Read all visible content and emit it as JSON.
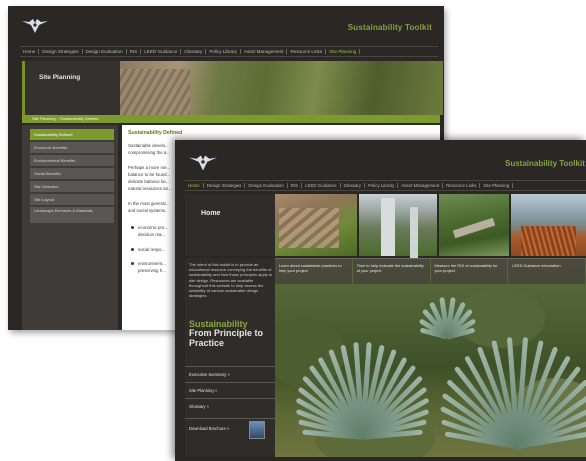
{
  "back": {
    "brand": "Sustainability Toolkit",
    "nav": [
      "Home",
      "Design Strategies",
      "Design Evaluation",
      "RIS",
      "LEED Guidance",
      "Glossary",
      "Policy Library",
      "Asset Management",
      "Resource Links",
      "Site Planning"
    ],
    "nav_active": 9,
    "hero_title": "Site Planning",
    "breadcrumb": "Site Planning :: Sustainability Defined",
    "sidebar": [
      "Sustainability Defined",
      "Economic Benefits",
      "Environmental Benefits",
      "Social Benefits",
      "Site Selection",
      "Site Layout",
      "Landscape Elements & Materials"
    ],
    "sidebar_active": 0,
    "content_heading": "Sustainability Defined",
    "content_text": [
      "Sustainable develo...",
      "compromising the a...",
      "Perhaps a more me...",
      "balance to be found...",
      "delicate balance be...",
      "natural resources an...",
      "In the most general...",
      "and social systems...",
      "economic pro...",
      "decision ma...",
      "social respo...",
      "environment...",
      "preserving h..."
    ]
  },
  "front": {
    "brand": "Sustainability Toolkit",
    "nav": [
      "Home",
      "Design Strategies",
      "Design Evaluation",
      "RIS",
      "LEED Guidance",
      "Glossary",
      "Policy Library",
      "Asset Management",
      "Resource Links",
      "Site Planning"
    ],
    "nav_active": 0,
    "home_title": "Home",
    "intro": "The intent of this toolkit is to provide an educational resource conveying the benefits of sustainability and how those principles apply to site design. Resources are available throughout this website to help assess the suitability of various sustainable design strategies.",
    "tagline_1": "Sustainability",
    "tagline_2": "From Principle to Practice",
    "links": [
      "Executive Summary »",
      "Site Planning »",
      "Glossary »"
    ],
    "download": "Download Brochure »",
    "features": [
      "Learn about sustainable practices to help your project",
      "Time to help evaluate the sustainability of your project",
      "Measure the ROI of sustainability for your project",
      "LEED Guidance information"
    ]
  }
}
